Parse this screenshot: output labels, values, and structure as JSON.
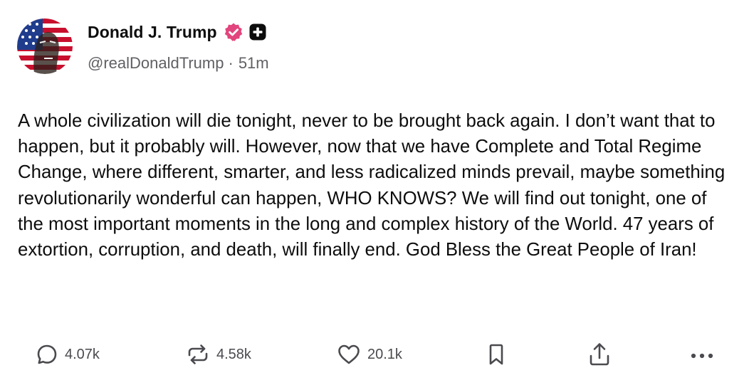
{
  "author": {
    "display_name": "Donald J. Trump",
    "handle": "@realDonaldTrump",
    "separator": "·",
    "time_ago": "51m",
    "verified_icon": "verified-badge-icon",
    "verified_color": "#e2457d",
    "extra_badge_icon": "plus-square-icon"
  },
  "post": {
    "text": "A whole civilization will die tonight, never to be brought back again. I don’t want that to happen, but it probably will. However, now that we have Complete and Total Regime Change, where different, smarter, and less radicalized minds prevail, maybe something revolutionarily wonderful can happen, WHO KNOWS? We will find out tonight, one of the most important moments in the long and complex history of the World. 47 years of extortion, corruption, and death, will finally end. God Bless the Great People of Iran!"
  },
  "actions": {
    "reply": {
      "icon": "reply-icon",
      "count": "4.07k"
    },
    "repost": {
      "icon": "repost-icon",
      "count": "4.58k"
    },
    "like": {
      "icon": "heart-icon",
      "count": "20.1k"
    },
    "bookmark": {
      "icon": "bookmark-icon"
    },
    "share": {
      "icon": "share-icon"
    },
    "more": {
      "icon": "more-icon"
    }
  },
  "colors": {
    "text": "#0d0d0d",
    "muted": "#606065",
    "icon": "#4a4a4f",
    "flag_red": "#c8102e",
    "flag_blue": "#1f3d8c"
  }
}
